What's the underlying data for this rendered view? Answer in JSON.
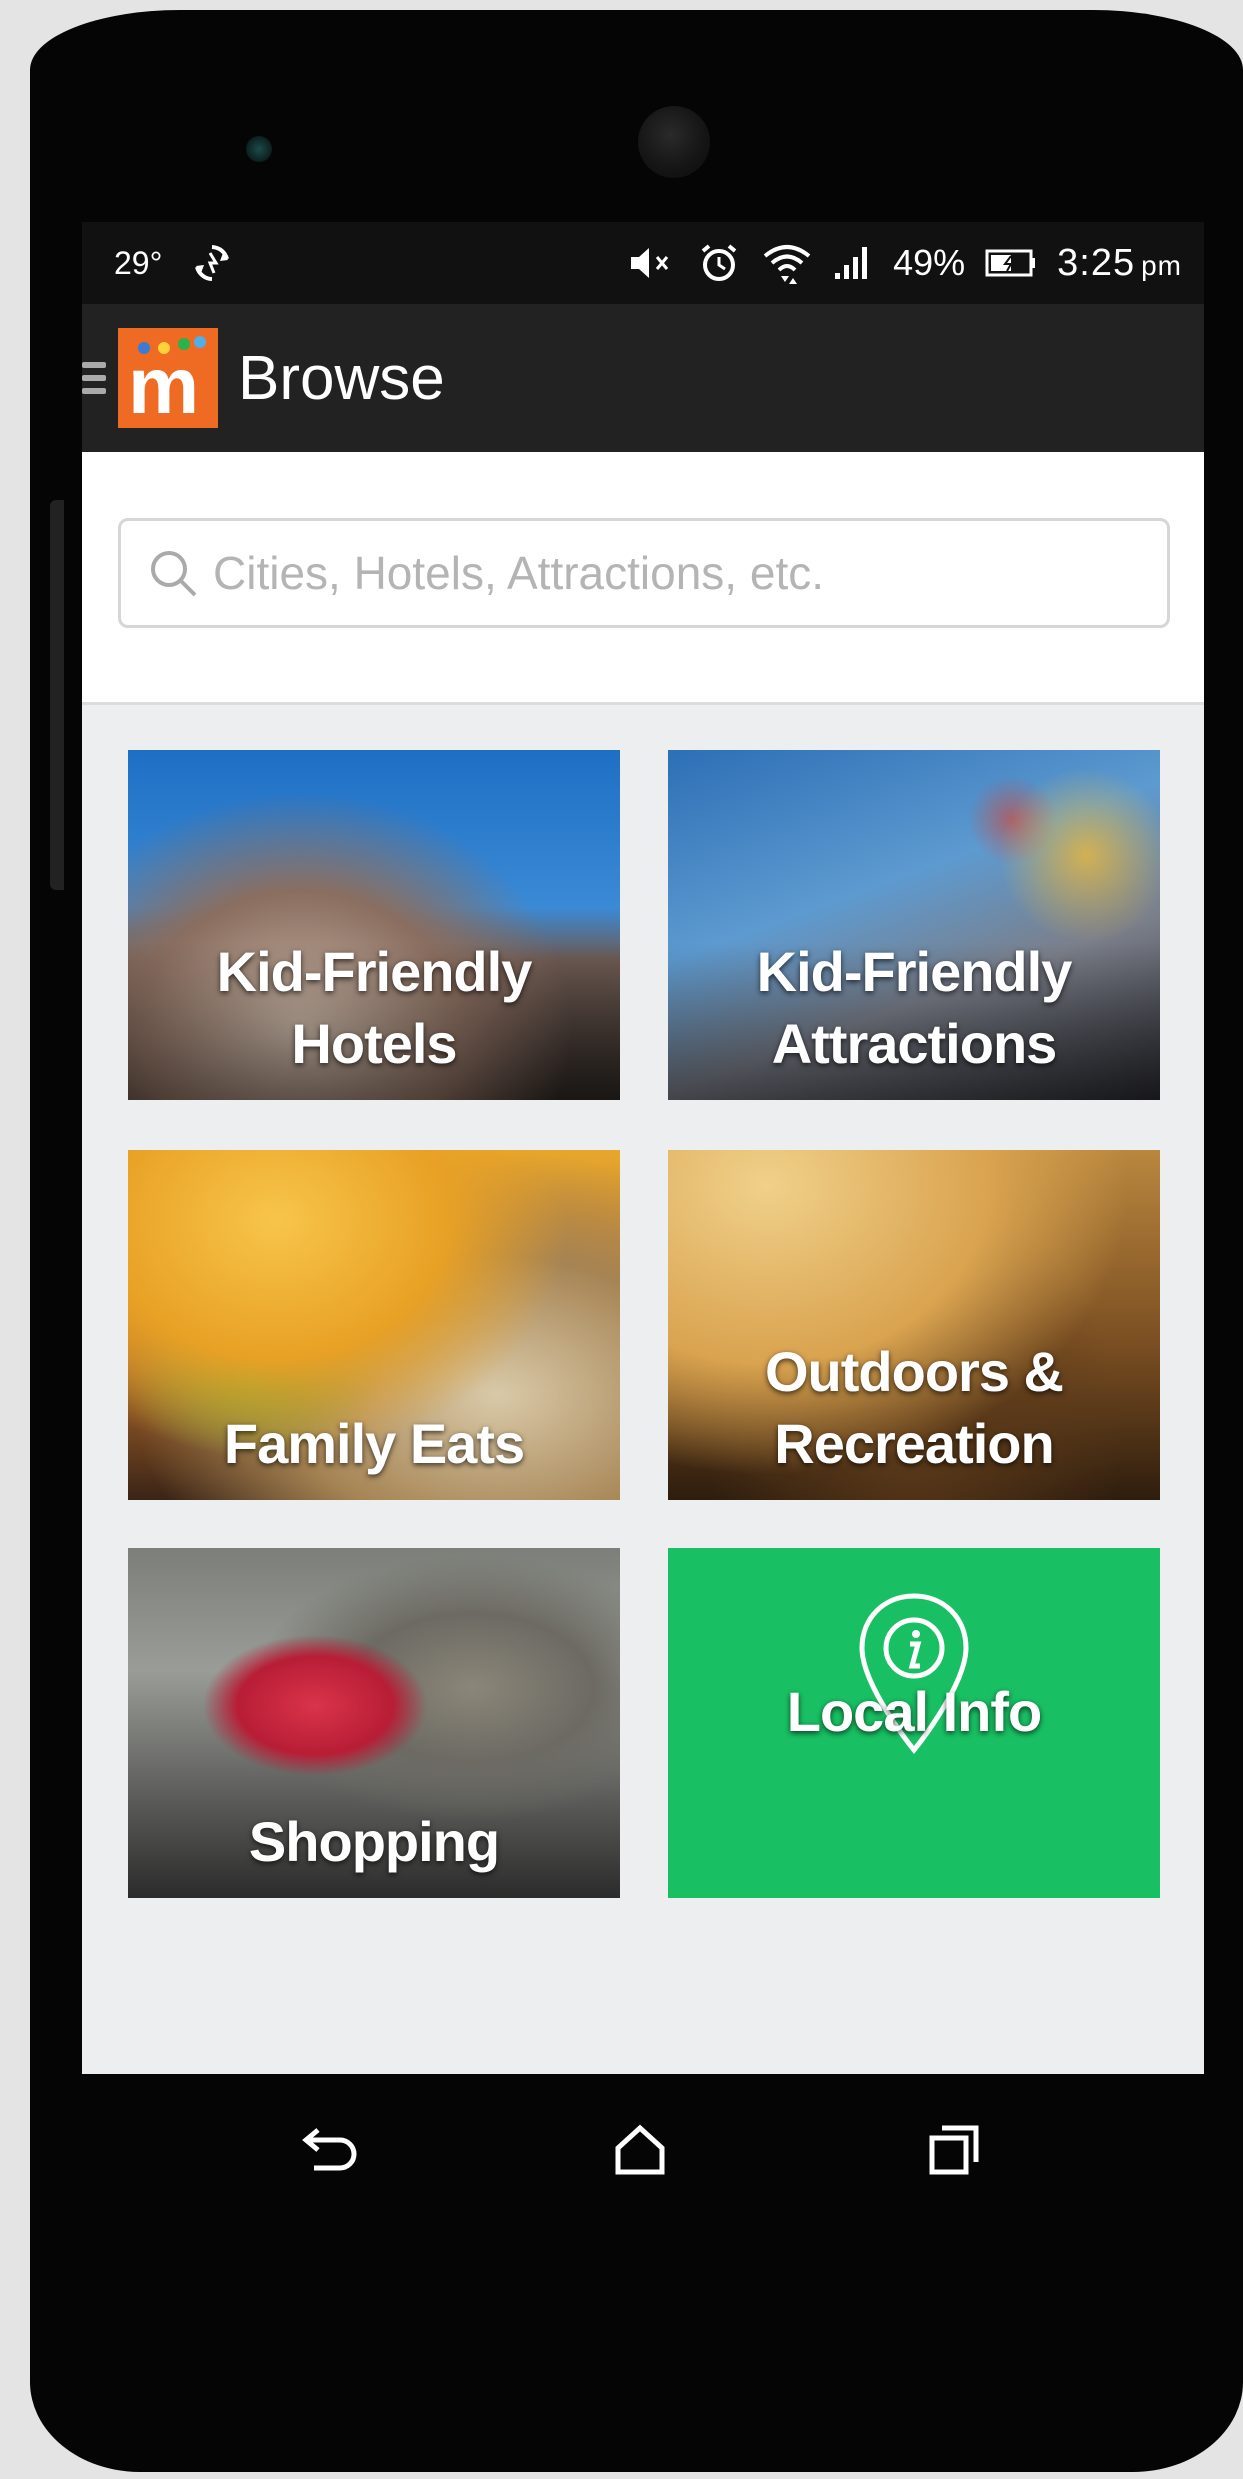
{
  "status_bar": {
    "temperature": "29°",
    "battery_percent": "49%",
    "time": "3:25",
    "ampm": "pm",
    "icons": [
      "sync-icon",
      "mute-icon",
      "alarm-icon",
      "wifi-icon",
      "signal-icon",
      "battery-icon"
    ]
  },
  "app_bar": {
    "title": "Browse",
    "logo_letter": "m",
    "logo_color": "#ef6a22"
  },
  "search": {
    "placeholder": "Cities, Hotels, Attractions, etc."
  },
  "tiles": [
    {
      "line1": "Kid-Friendly",
      "line2": "Hotels"
    },
    {
      "line1": "Kid-Friendly",
      "line2": "Attractions"
    },
    {
      "line1": "Family Eats",
      "line2": ""
    },
    {
      "line1": "Outdoors &",
      "line2": "Recreation"
    },
    {
      "line1": "Shopping",
      "line2": ""
    },
    {
      "line1": "Local Info",
      "line2": "",
      "color": "#18c063",
      "icon": "info-pin-icon"
    }
  ],
  "nav_bar": {
    "icons": [
      "back-icon",
      "home-icon",
      "recents-icon"
    ]
  }
}
